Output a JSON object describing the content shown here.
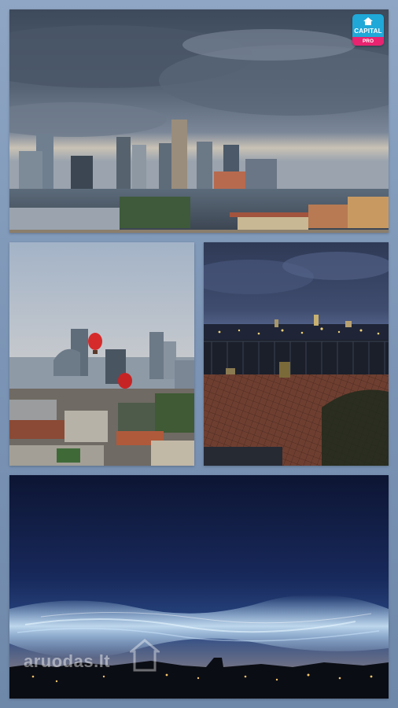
{
  "photos": [
    {
      "name": "skyline-storm-clouds"
    },
    {
      "name": "hot-air-balloons-over-city"
    },
    {
      "name": "night-view-from-balcony"
    },
    {
      "name": "noctilucent-clouds-night-sky"
    }
  ],
  "badge": {
    "brand": "CAPITAL",
    "tier": "PRO",
    "color": "#1fa8d8",
    "tier_color": "#e8236f"
  },
  "watermark": {
    "text": "aruodas.lt"
  }
}
